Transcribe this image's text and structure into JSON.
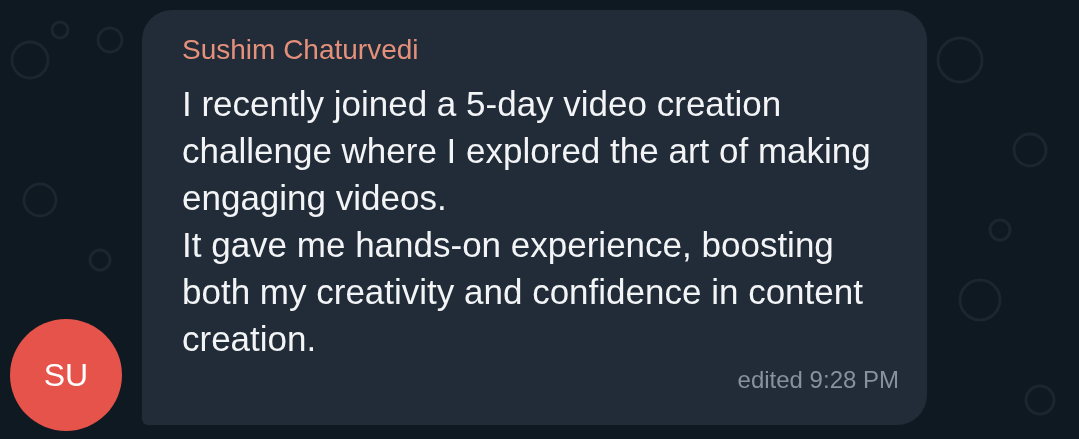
{
  "message": {
    "avatar": {
      "initials": "SU"
    },
    "sender": "Sushim Chaturvedi",
    "text": "I recently joined a 5-day video creation challenge where I explored the art of making engaging videos.\nIt gave me hands-on experience, boosting both my creativity and confidence in content creation.",
    "status": "edited 9:28 PM"
  }
}
